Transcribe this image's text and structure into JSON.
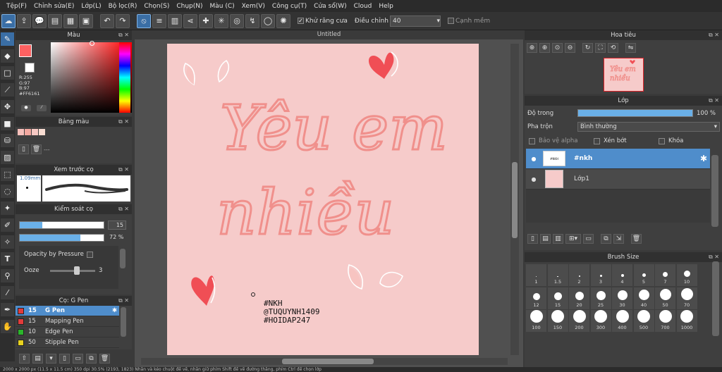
{
  "menu": [
    "Tệp(F)",
    "Chỉnh sửa(E)",
    "Lớp(L)",
    "Bộ lọc(R)",
    "Chọn(S)",
    "Chụp(N)",
    "Màu (C)",
    "Xem(V)",
    "Công cụ(T)",
    "Cửa sổ(W)",
    "Cloud",
    "Help"
  ],
  "toolbar": {
    "antialias_label": "Khử răng cưa",
    "adjust_label": "Điều chỉnh",
    "adjust_value": "40",
    "edge_label": "Cạnh mềm"
  },
  "color_panel": {
    "title": "Màu",
    "r": "R:255",
    "g": "G:97",
    "b": "B:97",
    "hex": "#FF6161",
    "current_color": "#ff6161"
  },
  "palette_panel": {
    "title": "Bảng màu",
    "swatches": [
      "#f6c0bb",
      "#f3a8a0",
      "#f7c9c4",
      "#f9ddd2"
    ],
    "placeholder": "---"
  },
  "preview_panel": {
    "title": "Xem trước cọ",
    "size": "1.09mm"
  },
  "brush_control": {
    "title": "Kiểm soát cọ",
    "size_value": "15",
    "opacity_value": "72 %",
    "size_fraction": 0.27,
    "opacity_fraction": 0.72,
    "pressure_label": "Opacity by Pressure",
    "ooze_label": "Ooze",
    "ooze_value": "3"
  },
  "brush_list": {
    "title": "Cọ: G Pen",
    "items": [
      {
        "size": "15",
        "name": "G Pen",
        "color": "#e23b3b",
        "selected": true
      },
      {
        "size": "15",
        "name": "Mapping Pen",
        "color": "#e23b3b",
        "selected": false
      },
      {
        "size": "10",
        "name": "Edge Pen",
        "color": "#2bb52b",
        "selected": false
      },
      {
        "size": "50",
        "name": "Stipple Pen",
        "color": "#e8d21e",
        "selected": false
      }
    ]
  },
  "document": {
    "tab_title": "Untitled",
    "text_line1": "#NKH",
    "text_line2": "@TUQUYNH1409",
    "text_line3": "#HOIDAP247",
    "script_line1": "Yêu em",
    "script_line2": "nhiều"
  },
  "navigator": {
    "title": "Hoa tiêu"
  },
  "layer_panel": {
    "title": "Lớp",
    "opacity_label": "Độ trong",
    "opacity_value": "100 %",
    "opacity_fraction": 1.0,
    "blend_label": "Pha trộn",
    "blend_value": "Bình thường",
    "protect_alpha_label": "Bảo vệ alpha",
    "clip_label": "Xén bớt",
    "lock_label": "Khóa",
    "layers": [
      {
        "name": "#nkh",
        "selected": true
      },
      {
        "name": "Lớp1",
        "selected": false
      }
    ]
  },
  "brush_size": {
    "title": "Brush Size",
    "sizes": [
      "1",
      "1.5",
      "2",
      "3",
      "4",
      "5",
      "7",
      "10",
      "12",
      "15",
      "20",
      "25",
      "30",
      "40",
      "50",
      "70",
      "100",
      "150",
      "200",
      "300",
      "400",
      "500",
      "700",
      "1000"
    ]
  },
  "statusbar": "2000 x 2000 px  (11.5 x 11.5 cm)  350 dpi  30.5%  (2193, 1823)  Nhấn và kéo chuột để vẽ, nhấn giữ phím Shift để vẽ đường thẳng, phím Ctrl để chọn lớp"
}
